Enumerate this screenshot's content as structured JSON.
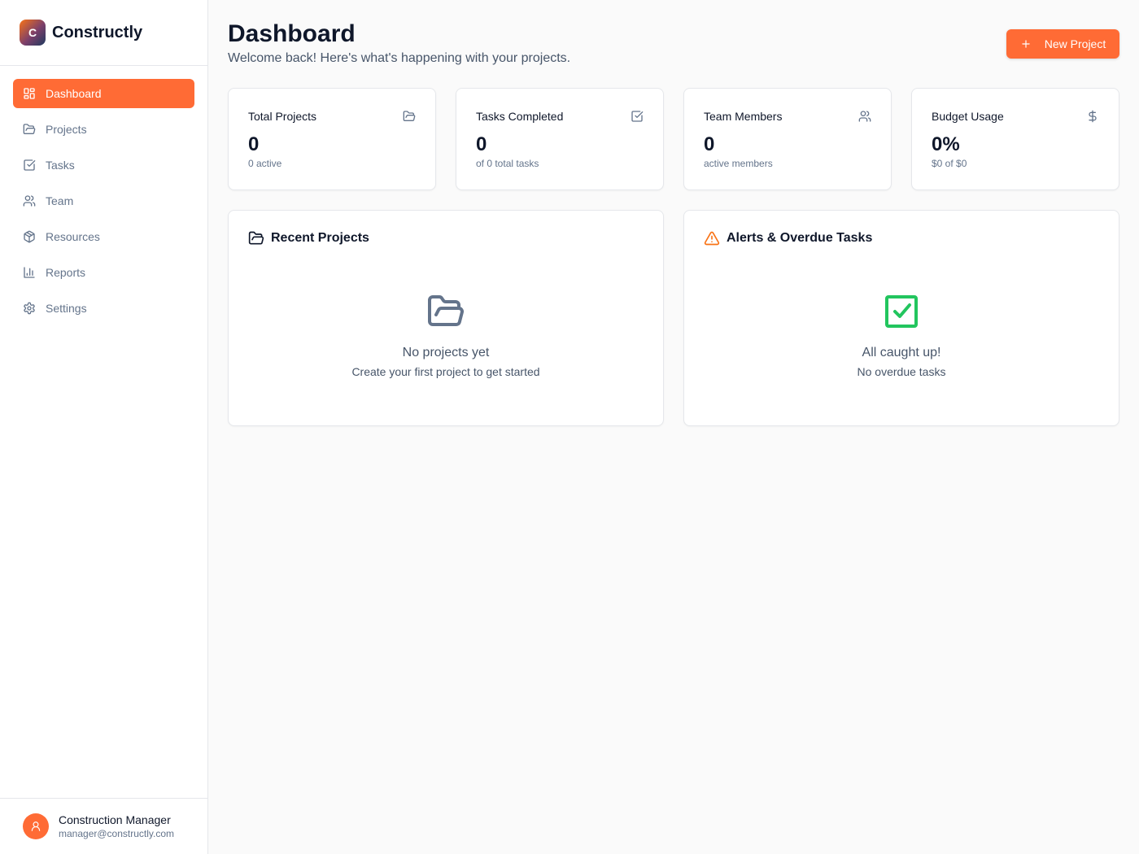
{
  "app": {
    "logo_letter": "C",
    "name": "Constructly"
  },
  "sidebar": {
    "items": [
      {
        "label": "Dashboard",
        "icon": "layout-dashboard-icon",
        "active": true
      },
      {
        "label": "Projects",
        "icon": "folder-open-icon",
        "active": false
      },
      {
        "label": "Tasks",
        "icon": "check-square-icon",
        "active": false
      },
      {
        "label": "Team",
        "icon": "users-icon",
        "active": false
      },
      {
        "label": "Resources",
        "icon": "package-icon",
        "active": false
      },
      {
        "label": "Reports",
        "icon": "bar-chart-icon",
        "active": false
      },
      {
        "label": "Settings",
        "icon": "gear-icon",
        "active": false
      }
    ]
  },
  "user": {
    "name": "Construction Manager",
    "email": "manager@constructly.com"
  },
  "header": {
    "title": "Dashboard",
    "subtitle": "Welcome back! Here's what's happening with your projects.",
    "new_project_label": "New Project"
  },
  "stats": [
    {
      "label": "Total Projects",
      "value": "0",
      "note": "0 active",
      "icon": "folder-open-icon"
    },
    {
      "label": "Tasks Completed",
      "value": "0",
      "note": "of 0 total tasks",
      "icon": "check-square-icon"
    },
    {
      "label": "Team Members",
      "value": "0",
      "note": "active members",
      "icon": "users-icon"
    },
    {
      "label": "Budget Usage",
      "value": "0%",
      "note": "$0 of $0",
      "icon": "dollar-icon"
    }
  ],
  "recent_projects": {
    "title": "Recent Projects",
    "empty_title": "No projects yet",
    "empty_subtitle": "Create your first project to get started"
  },
  "alerts": {
    "title": "Alerts & Overdue Tasks",
    "empty_title": "All caught up!",
    "empty_subtitle": "No overdue tasks"
  },
  "colors": {
    "accent": "#ff6b35",
    "success": "#22c55e",
    "warning": "#f97316"
  }
}
